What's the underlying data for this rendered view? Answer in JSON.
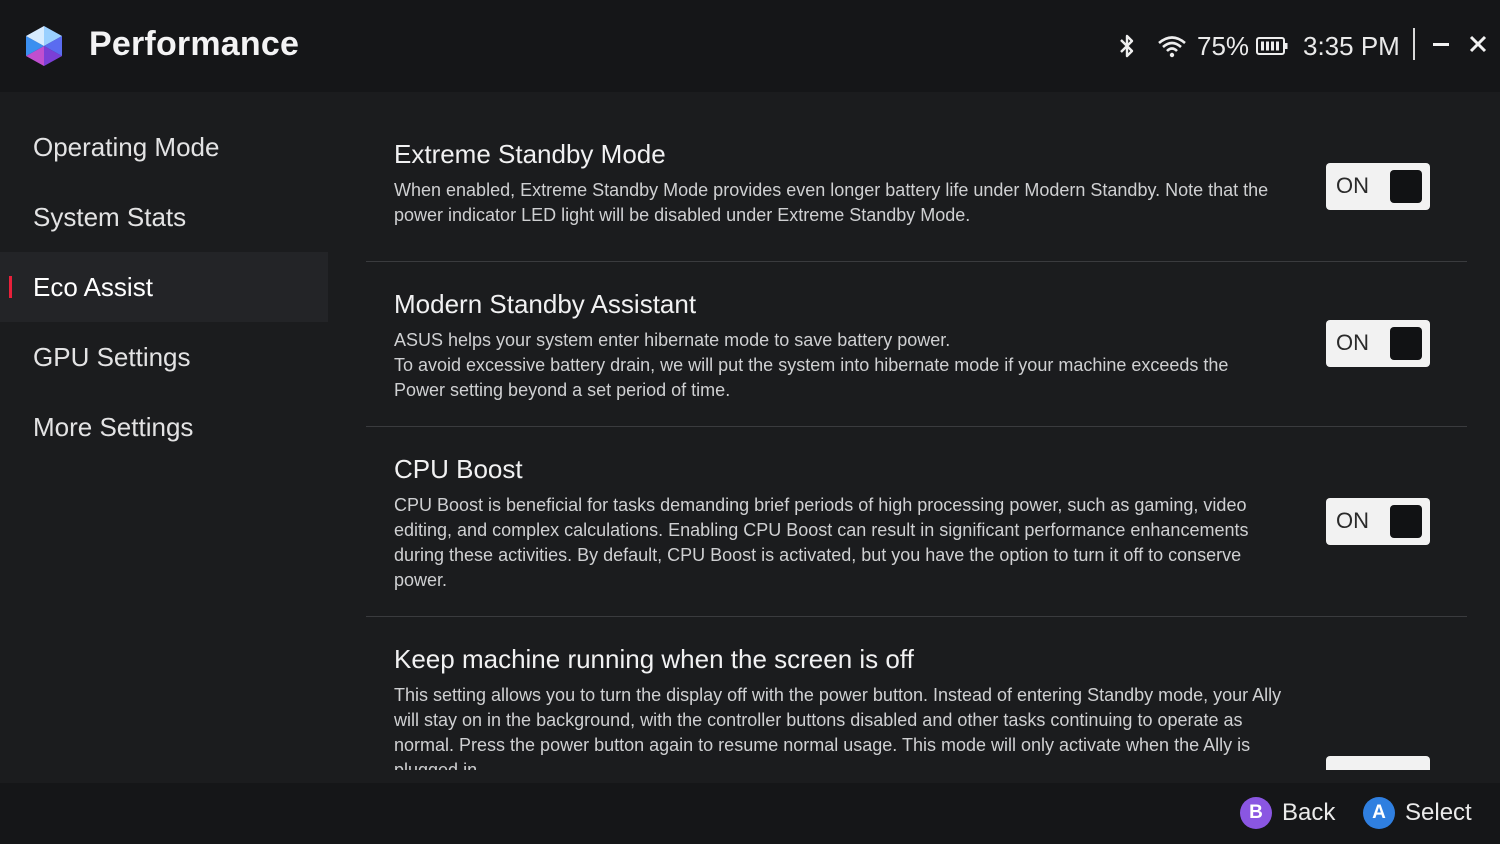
{
  "header": {
    "title": "Performance",
    "battery_percent": "75%",
    "time": "3:35 PM",
    "icons": [
      "bluetooth-icon",
      "wifi-icon",
      "battery-icon",
      "minimize-icon",
      "close-icon"
    ]
  },
  "sidebar": {
    "items": [
      {
        "label": "Operating Mode"
      },
      {
        "label": "System Stats"
      },
      {
        "label": "Eco Assist"
      },
      {
        "label": "GPU Settings"
      },
      {
        "label": "More Settings"
      }
    ],
    "active_index": 2,
    "accent_color": "#e8203a"
  },
  "settings": [
    {
      "title": "Extreme Standby Mode",
      "description": "When enabled, Extreme Standby Mode provides even longer battery life under Modern Standby. Note that the power indicator LED light will be disabled under Extreme Standby Mode.",
      "toggle_label": "ON"
    },
    {
      "title": "Modern Standby Assistant",
      "description_lines": [
        "ASUS helps your system enter hibernate mode to save battery power.",
        "To avoid excessive battery drain, we will put the system into hibernate mode if your machine exceeds the Power setting beyond a set period of time."
      ],
      "toggle_label": "ON"
    },
    {
      "title": "CPU Boost",
      "description": "CPU Boost is beneficial for tasks demanding brief periods of high processing power, such as gaming, video editing, and complex calculations. Enabling CPU Boost can result in significant performance enhancements during these activities. By default, CPU Boost is activated, but you have the option to turn it off to conserve power.",
      "toggle_label": "ON"
    },
    {
      "title": "Keep machine running when the screen is off",
      "description": "This setting allows you to turn the display off with the power button. Instead of entering Standby mode, your Ally will stay on in the background, with the controller buttons disabled and other tasks continuing to operate as normal. Press the power button again to resume normal usage. This mode will only activate when the Ally is plugged in."
    }
  ],
  "footer": {
    "back": {
      "key": "B",
      "label": "Back",
      "color": "#8a56e2"
    },
    "select": {
      "key": "A",
      "label": "Select",
      "color": "#2f7fe0"
    }
  }
}
